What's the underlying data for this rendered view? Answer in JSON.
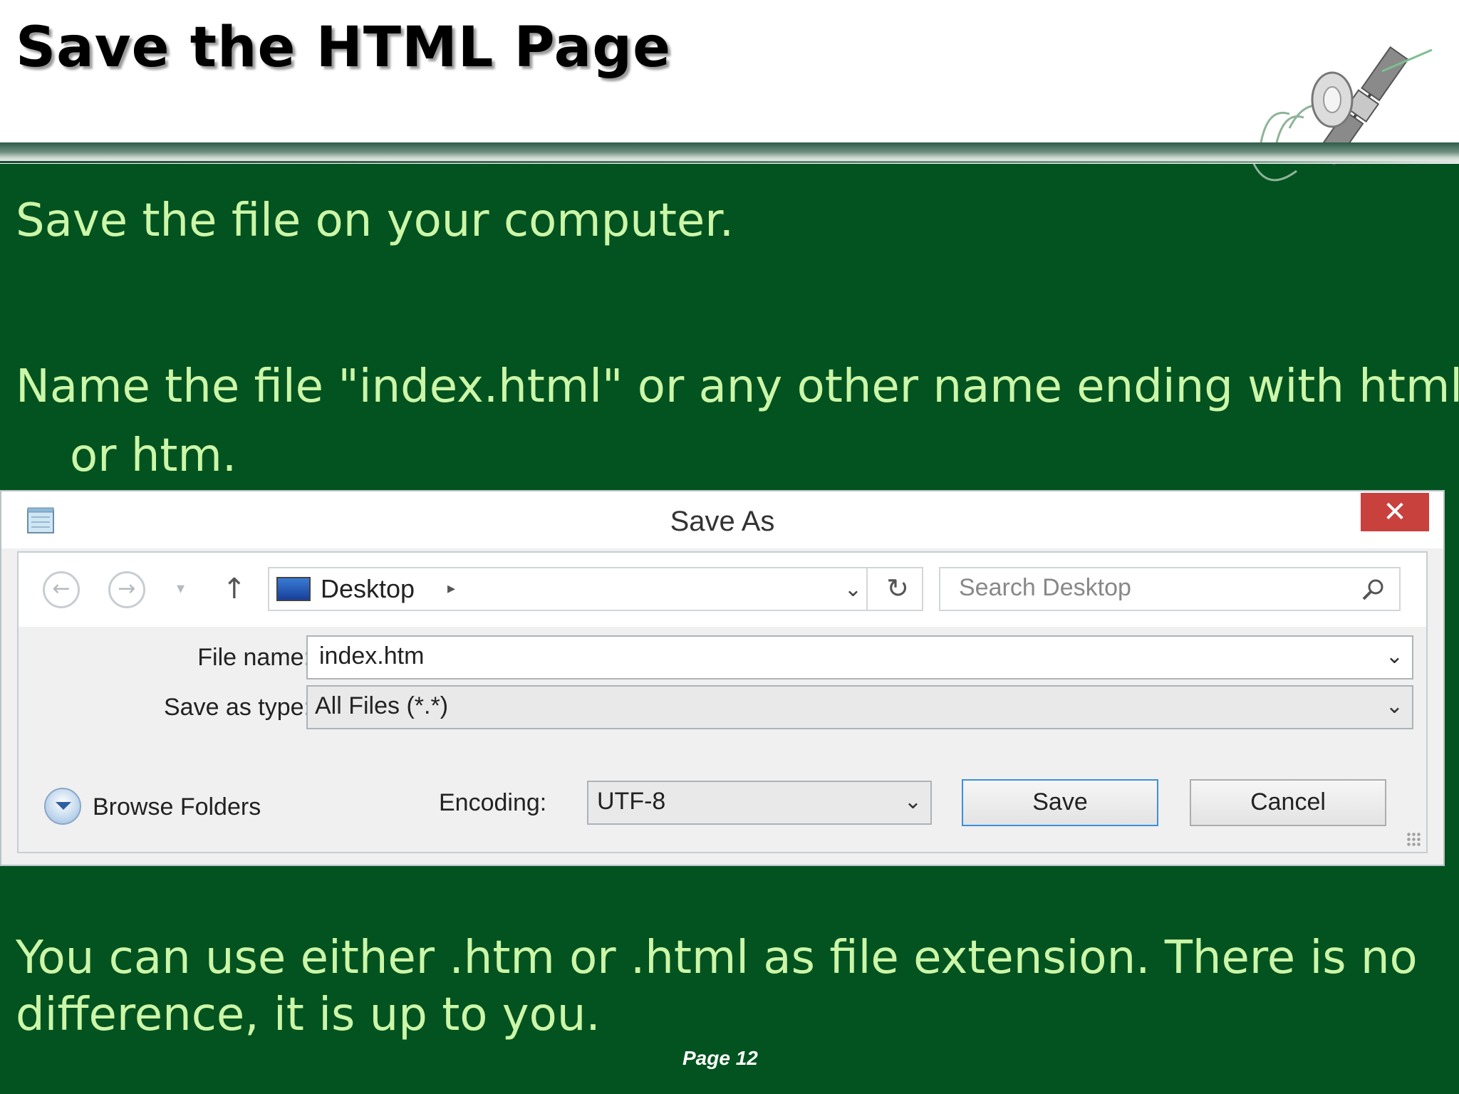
{
  "slide": {
    "title": "Save the HTML Page",
    "line1": "Save the file on your computer.",
    "line2a": "Name the file \"index.html\" or any other name ending with html",
    "line2b": "or htm.",
    "line3a": "You can use either .htm or .html as file extension. There is no",
    "line3b": "difference, it is up to you.",
    "page_label": "Page  12"
  },
  "dialog": {
    "title": "Save As",
    "close_label": "✕",
    "nav": {
      "back_label": "←",
      "forward_label": "→",
      "recent_label": "▾",
      "up_label": "↑",
      "address": "Desktop",
      "address_arrow": "▸",
      "address_chevron": "⌄",
      "refresh_label": "↻",
      "search_placeholder": "Search Desktop"
    },
    "filename_label": "File name:",
    "filename_value": "index.htm",
    "filetype_label": "Save as type:",
    "filetype_value": "All Files  (*.*)",
    "browse_label": "Browse Folders",
    "encoding_label": "Encoding:",
    "encoding_value": "UTF-8",
    "save_label": "Save",
    "cancel_label": "Cancel",
    "chevron": "⌄"
  },
  "colors": {
    "background": "#02531f",
    "text": "#ccf6a8",
    "close": "#c9413d",
    "save_border": "#3c8fde"
  }
}
